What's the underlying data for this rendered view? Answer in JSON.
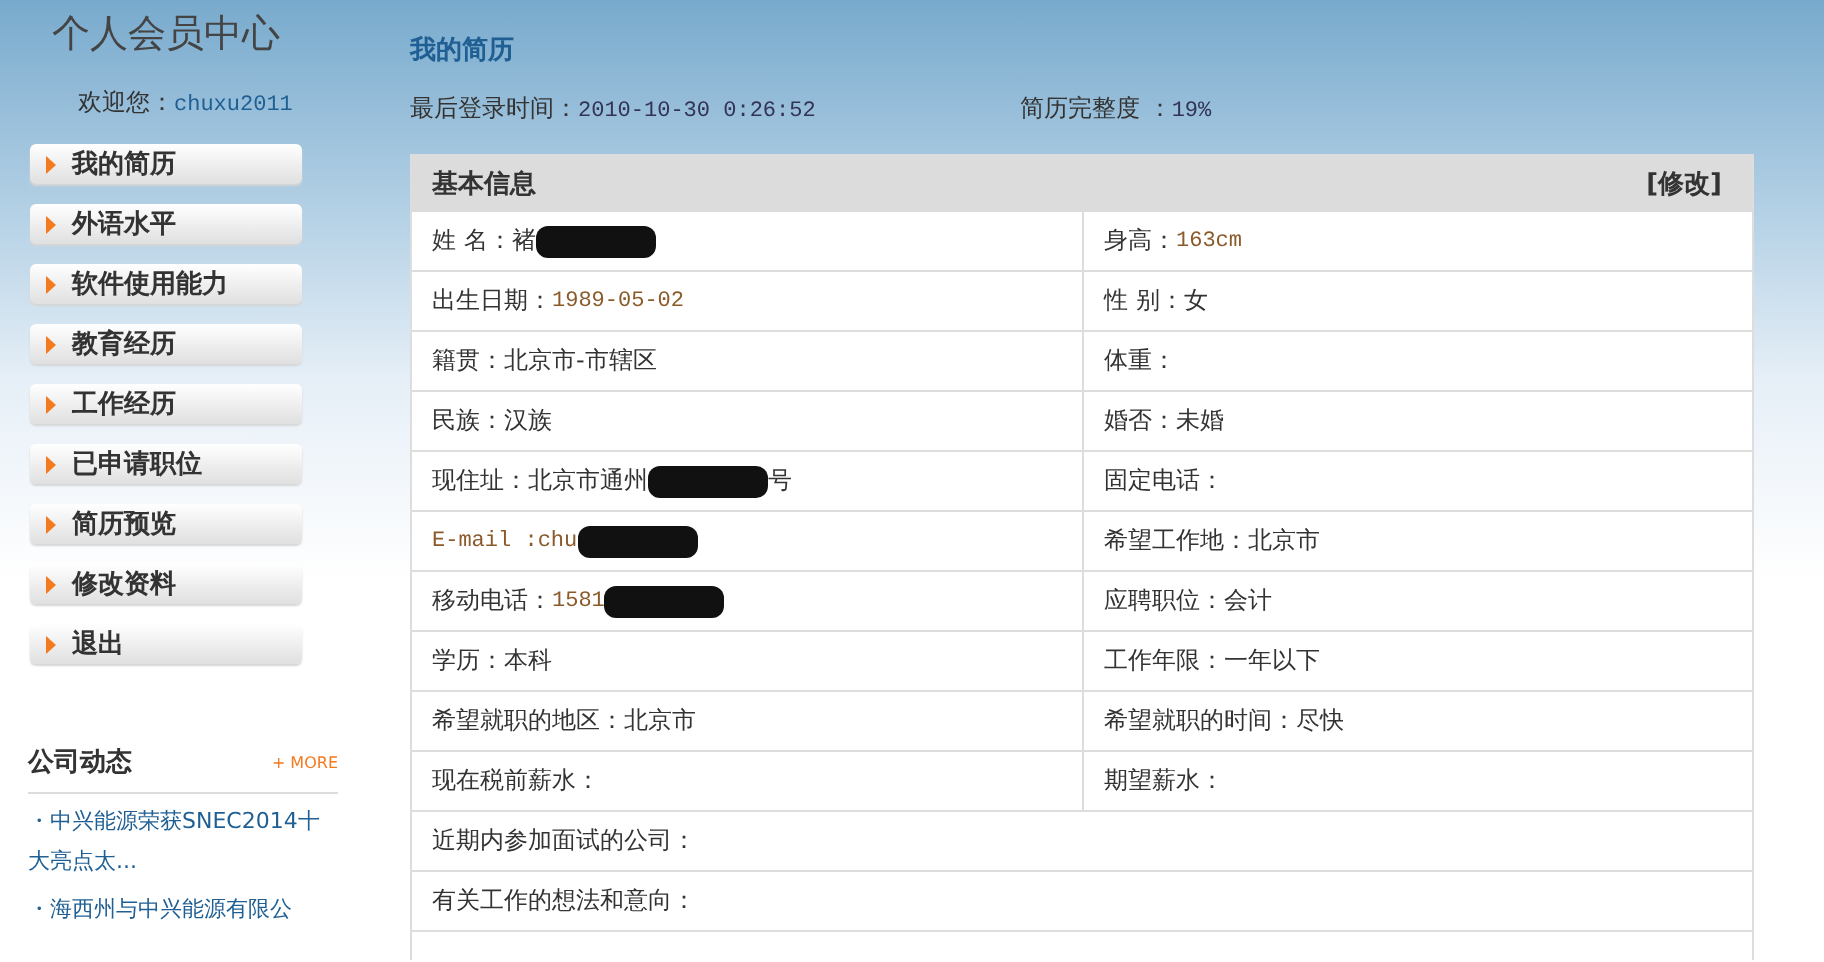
{
  "sidebar": {
    "title": "个人会员中心",
    "welcome_label": "欢迎您：",
    "username": "chuxu2011",
    "menu": [
      {
        "label": "我的简历"
      },
      {
        "label": "外语水平"
      },
      {
        "label": "软件使用能力"
      },
      {
        "label": "教育经历"
      },
      {
        "label": "工作经历"
      },
      {
        "label": "已申请职位"
      },
      {
        "label": "简历预览"
      },
      {
        "label": "修改资料"
      },
      {
        "label": "退出"
      }
    ],
    "news": {
      "title": "公司动态",
      "more": "+ MORE",
      "items": [
        "・中兴能源荣获SNEC2014十大亮点太...",
        "・海西州与中兴能源有限公"
      ]
    }
  },
  "main": {
    "title": "我的简历",
    "last_login_label": "最后登录时间：",
    "last_login": "2010-10-30 0:26:52",
    "completeness_label": "简历完整度 ：",
    "completeness": "19%",
    "section": {
      "title": "基本信息",
      "edit": "[修改]",
      "rows": [
        [
          {
            "label": "姓 名：",
            "value": "褚",
            "kind": "plain",
            "redacted": true
          },
          {
            "label": "身高：",
            "value": "163cm",
            "kind": "mono"
          }
        ],
        [
          {
            "label": "出生日期：",
            "value": "1989-05-02",
            "kind": "mono"
          },
          {
            "label": "性 别：",
            "value": "女",
            "kind": "plain"
          }
        ],
        [
          {
            "label": "籍贯：",
            "value": "北京市-市辖区",
            "kind": "plain"
          },
          {
            "label": "体重：",
            "kind": "plain"
          }
        ],
        [
          {
            "label": "民族：",
            "value": "汉族",
            "kind": "plain"
          },
          {
            "label": "婚否：",
            "value": "未婚",
            "kind": "plain"
          }
        ],
        [
          {
            "label": "现住址：",
            "value": "北京市通州",
            "kind": "plain",
            "redacted": true,
            "tail": "号"
          },
          {
            "label": "固定电话：",
            "kind": "plain"
          }
        ],
        [
          {
            "label": "E-mail : ",
            "value": "chu",
            "kind": "mono",
            "redacted": true
          },
          {
            "label": "希望工作地：",
            "value": "北京市",
            "kind": "plain"
          }
        ],
        [
          {
            "label": "移动电话：",
            "value": "1581",
            "kind": "mono",
            "redacted": true
          },
          {
            "label": "应聘职位：",
            "value": "会计",
            "kind": "plain"
          }
        ],
        [
          {
            "label": "学历：",
            "value": "本科",
            "kind": "plain"
          },
          {
            "label": "工作年限：",
            "value": "一年以下",
            "kind": "plain"
          }
        ],
        [
          {
            "label": "希望就职的地区：",
            "value": "北京市",
            "kind": "plain"
          },
          {
            "label": "希望就职的时间：",
            "value": "尽快",
            "kind": "plain"
          }
        ],
        [
          {
            "label": "现在税前薪水：",
            "kind": "plain"
          },
          {
            "label": "期望薪水：",
            "kind": "plain"
          }
        ],
        [
          {
            "label": "近期内参加面试的公司：",
            "kind": "plain"
          }
        ],
        [
          {
            "label": "有关工作的想法和意向：",
            "kind": "plain"
          }
        ]
      ]
    }
  }
}
